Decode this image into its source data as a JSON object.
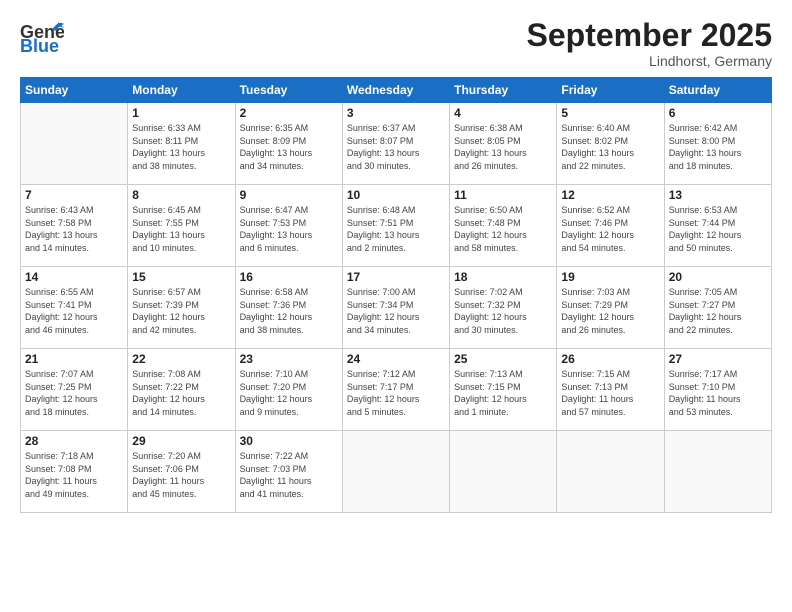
{
  "header": {
    "logo_line1": "General",
    "logo_line2": "Blue",
    "month": "September 2025",
    "location": "Lindhorst, Germany"
  },
  "weekdays": [
    "Sunday",
    "Monday",
    "Tuesday",
    "Wednesday",
    "Thursday",
    "Friday",
    "Saturday"
  ],
  "weeks": [
    [
      {
        "day": "",
        "info": ""
      },
      {
        "day": "1",
        "info": "Sunrise: 6:33 AM\nSunset: 8:11 PM\nDaylight: 13 hours\nand 38 minutes."
      },
      {
        "day": "2",
        "info": "Sunrise: 6:35 AM\nSunset: 8:09 PM\nDaylight: 13 hours\nand 34 minutes."
      },
      {
        "day": "3",
        "info": "Sunrise: 6:37 AM\nSunset: 8:07 PM\nDaylight: 13 hours\nand 30 minutes."
      },
      {
        "day": "4",
        "info": "Sunrise: 6:38 AM\nSunset: 8:05 PM\nDaylight: 13 hours\nand 26 minutes."
      },
      {
        "day": "5",
        "info": "Sunrise: 6:40 AM\nSunset: 8:02 PM\nDaylight: 13 hours\nand 22 minutes."
      },
      {
        "day": "6",
        "info": "Sunrise: 6:42 AM\nSunset: 8:00 PM\nDaylight: 13 hours\nand 18 minutes."
      }
    ],
    [
      {
        "day": "7",
        "info": "Sunrise: 6:43 AM\nSunset: 7:58 PM\nDaylight: 13 hours\nand 14 minutes."
      },
      {
        "day": "8",
        "info": "Sunrise: 6:45 AM\nSunset: 7:55 PM\nDaylight: 13 hours\nand 10 minutes."
      },
      {
        "day": "9",
        "info": "Sunrise: 6:47 AM\nSunset: 7:53 PM\nDaylight: 13 hours\nand 6 minutes."
      },
      {
        "day": "10",
        "info": "Sunrise: 6:48 AM\nSunset: 7:51 PM\nDaylight: 13 hours\nand 2 minutes."
      },
      {
        "day": "11",
        "info": "Sunrise: 6:50 AM\nSunset: 7:48 PM\nDaylight: 12 hours\nand 58 minutes."
      },
      {
        "day": "12",
        "info": "Sunrise: 6:52 AM\nSunset: 7:46 PM\nDaylight: 12 hours\nand 54 minutes."
      },
      {
        "day": "13",
        "info": "Sunrise: 6:53 AM\nSunset: 7:44 PM\nDaylight: 12 hours\nand 50 minutes."
      }
    ],
    [
      {
        "day": "14",
        "info": "Sunrise: 6:55 AM\nSunset: 7:41 PM\nDaylight: 12 hours\nand 46 minutes."
      },
      {
        "day": "15",
        "info": "Sunrise: 6:57 AM\nSunset: 7:39 PM\nDaylight: 12 hours\nand 42 minutes."
      },
      {
        "day": "16",
        "info": "Sunrise: 6:58 AM\nSunset: 7:36 PM\nDaylight: 12 hours\nand 38 minutes."
      },
      {
        "day": "17",
        "info": "Sunrise: 7:00 AM\nSunset: 7:34 PM\nDaylight: 12 hours\nand 34 minutes."
      },
      {
        "day": "18",
        "info": "Sunrise: 7:02 AM\nSunset: 7:32 PM\nDaylight: 12 hours\nand 30 minutes."
      },
      {
        "day": "19",
        "info": "Sunrise: 7:03 AM\nSunset: 7:29 PM\nDaylight: 12 hours\nand 26 minutes."
      },
      {
        "day": "20",
        "info": "Sunrise: 7:05 AM\nSunset: 7:27 PM\nDaylight: 12 hours\nand 22 minutes."
      }
    ],
    [
      {
        "day": "21",
        "info": "Sunrise: 7:07 AM\nSunset: 7:25 PM\nDaylight: 12 hours\nand 18 minutes."
      },
      {
        "day": "22",
        "info": "Sunrise: 7:08 AM\nSunset: 7:22 PM\nDaylight: 12 hours\nand 14 minutes."
      },
      {
        "day": "23",
        "info": "Sunrise: 7:10 AM\nSunset: 7:20 PM\nDaylight: 12 hours\nand 9 minutes."
      },
      {
        "day": "24",
        "info": "Sunrise: 7:12 AM\nSunset: 7:17 PM\nDaylight: 12 hours\nand 5 minutes."
      },
      {
        "day": "25",
        "info": "Sunrise: 7:13 AM\nSunset: 7:15 PM\nDaylight: 12 hours\nand 1 minute."
      },
      {
        "day": "26",
        "info": "Sunrise: 7:15 AM\nSunset: 7:13 PM\nDaylight: 11 hours\nand 57 minutes."
      },
      {
        "day": "27",
        "info": "Sunrise: 7:17 AM\nSunset: 7:10 PM\nDaylight: 11 hours\nand 53 minutes."
      }
    ],
    [
      {
        "day": "28",
        "info": "Sunrise: 7:18 AM\nSunset: 7:08 PM\nDaylight: 11 hours\nand 49 minutes."
      },
      {
        "day": "29",
        "info": "Sunrise: 7:20 AM\nSunset: 7:06 PM\nDaylight: 11 hours\nand 45 minutes."
      },
      {
        "day": "30",
        "info": "Sunrise: 7:22 AM\nSunset: 7:03 PM\nDaylight: 11 hours\nand 41 minutes."
      },
      {
        "day": "",
        "info": ""
      },
      {
        "day": "",
        "info": ""
      },
      {
        "day": "",
        "info": ""
      },
      {
        "day": "",
        "info": ""
      }
    ]
  ]
}
